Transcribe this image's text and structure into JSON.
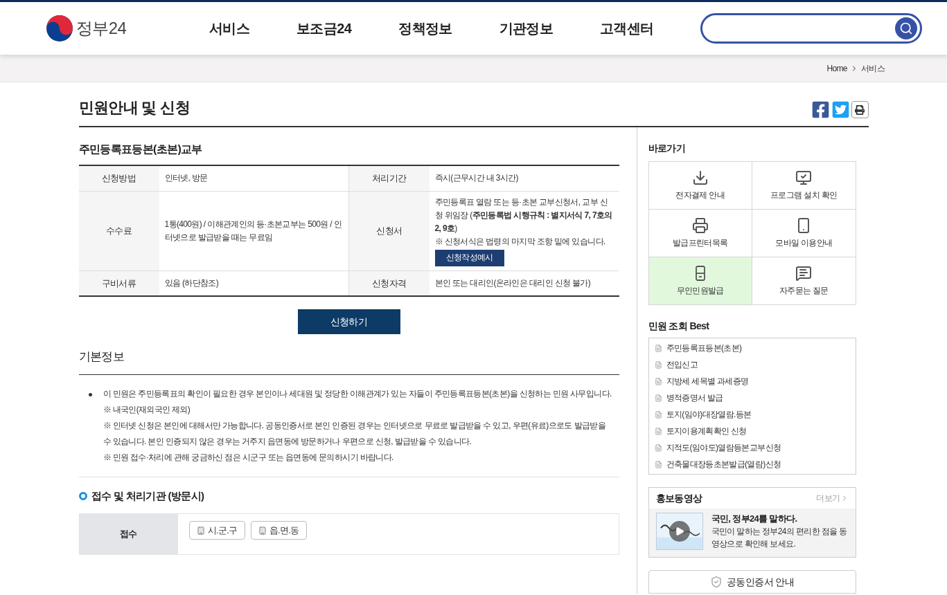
{
  "header": {
    "logo_text": "정부24",
    "nav": [
      {
        "label": "서비스"
      },
      {
        "label": "보조금24"
      },
      {
        "label": "정책정보"
      },
      {
        "label": "기관정보"
      },
      {
        "label": "고객센터"
      }
    ]
  },
  "breadcrumb": [
    "Home",
    "서비스"
  ],
  "page_title": "민원안내 및 신청",
  "service": {
    "title": "주민등록표등본(초본)교부",
    "rows": [
      {
        "label1": "신청방법",
        "value1": "인터넷, 방문",
        "label2": "처리기간",
        "value2": "즉시(근무시간 내 3시간)"
      },
      {
        "label1": "수수료",
        "value1": "1통(400원) / 이해관계인의 등·초본교부는 500원 / 인터넷으로 발급받을 때는 무료임",
        "label2": "신청서",
        "value2": "주민등록표 열람 또는 등·초본 교부신청서, 교부 신청 위임장 (**주민등록법 시행규칙 : 별지서식 7, 7호의2, 9호**)",
        "note": "※ 신청서식은 법령의 마지막 조항 밑에 있습니다.",
        "button": "신청작성예시"
      },
      {
        "label1": "구비서류",
        "value1": "있음 (하단참조)",
        "label2": "신청자격",
        "value2": "본인 또는 대리인(온라인은 대리인 신청 불가)"
      }
    ],
    "apply_button": "신청하기"
  },
  "basic_info": {
    "title": "기본정보",
    "paragraph": "이 민원은 주민등록표의 확인이 필요한 경우 본인이나 세대원 및 정당한 이해관계가 있는 자들이 주민등록표등본(초본)을 신청하는 민원 사무입니다.",
    "notes": [
      "※ 내국인(재외국인 제외)",
      "※ 인터넷 신청은 본인에 대해서만 가능합니다. 공동인증서로 본인 인증된 경우는 인터넷으로 무료로 발급받을 수 있고, 우편(유료)으로도 발급받을 수 있습니다. 본인 인증되지 않은 경우는 거주지 읍면동에 방문하거나 우편으로 신청, 발급받을 수 있습니다.",
      "※ 민원 접수·처리에 관해 궁금하신 점은 시군구 또는 읍면동에 문의하시기 바랍니다."
    ]
  },
  "agency": {
    "title": "접수 및 처리기관 (방문시)",
    "row_label": "접수",
    "buttons": [
      "시.군.구",
      "읍.면.동"
    ]
  },
  "sidebar": {
    "quick_title": "바로가기",
    "quick_links": [
      {
        "label": "전자결제 안내",
        "kind": "download",
        "selected": false
      },
      {
        "label": "프로그램 설치 확인",
        "kind": "monitor",
        "selected": false
      },
      {
        "label": "발급프린터목록",
        "kind": "printer",
        "selected": false
      },
      {
        "label": "모바일 이용안내",
        "kind": "mobile",
        "selected": false
      },
      {
        "label": "무인민원발급",
        "kind": "kiosk",
        "selected": true
      },
      {
        "label": "자주묻는 질문",
        "kind": "chat",
        "selected": false
      }
    ],
    "best_title": "민원 조회 Best",
    "best": [
      "주민등록표등본(초본)",
      "전입신고",
      "지방세 세목별 과세증명",
      "병적증명서 발급",
      "토지(임야)대장열람.등본",
      "토지이용계획확인 신청",
      "지적도(임야도)열람등본교부신청",
      "건축물대장등초본발급(열람)신청"
    ],
    "video": {
      "title": "홍보동영상",
      "more": "더보기",
      "headline": "국민, 정부24를 말하다.",
      "description": "국민이 말하는 정부24의 편리한 점을 동영상으로 확인해 보세요."
    },
    "cert": "공동인증서 안내"
  }
}
